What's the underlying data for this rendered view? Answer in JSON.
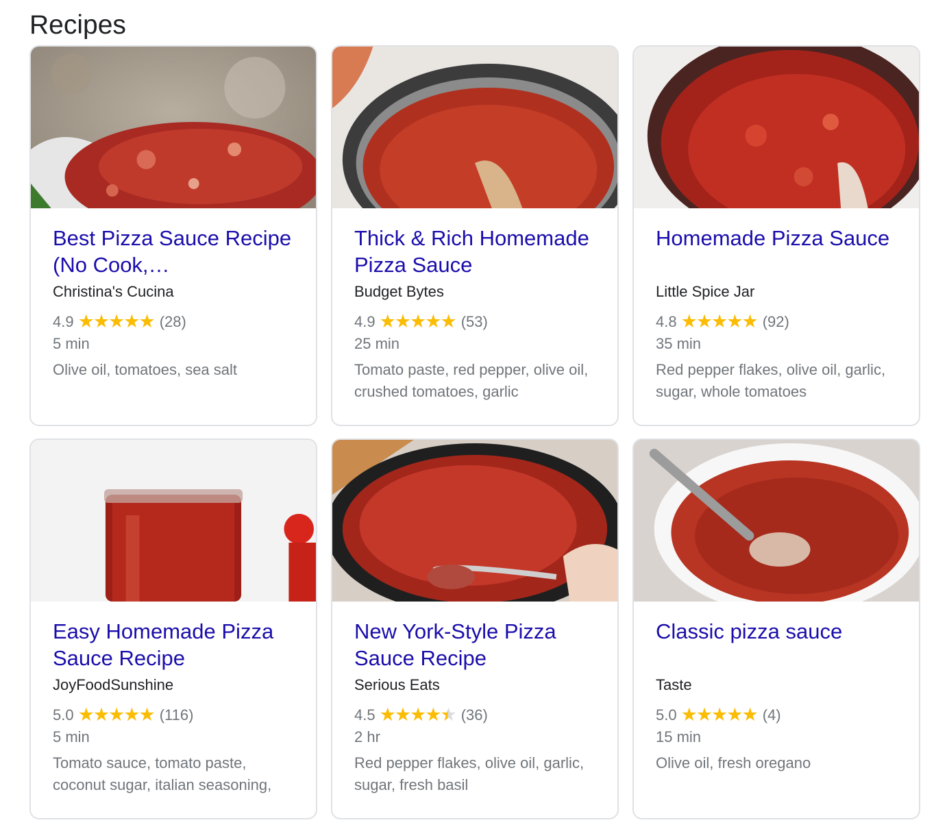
{
  "heading": "Recipes",
  "colors": {
    "title_link": "#1a0dab",
    "star": "#fbbc04",
    "meta": "#70757a",
    "sauce": "#c0301f"
  },
  "cards": [
    {
      "title": "Best Pizza Sauce Recipe (No Cook,…",
      "source": "Christina's Cucina",
      "rating": "4.9",
      "rating_value": 4.9,
      "reviews": "(28)",
      "time": "5 min",
      "ingredients": "Olive oil, tomatoes, sea salt",
      "image": "sauce-on-spoon-photo"
    },
    {
      "title": "Thick & Rich Homemade Pizza Sauce",
      "source": "Budget Bytes",
      "rating": "4.9",
      "rating_value": 4.9,
      "reviews": "(53)",
      "time": "25 min",
      "ingredients": "Tomato paste, red pepper, olive oil, crushed tomatoes, garlic",
      "image": "sauce-in-pot-photo"
    },
    {
      "title": "Homemade Pizza Sauce",
      "source": "Little Spice Jar",
      "rating": "4.8",
      "rating_value": 4.8,
      "reviews": "(92)",
      "time": "35 min",
      "ingredients": "Red pepper flakes, olive oil, garlic, sugar, whole tomatoes",
      "image": "chunky-sauce-pot-photo"
    },
    {
      "title": "Easy Homemade Pizza Sauce Recipe",
      "source": "JoyFoodSunshine",
      "rating": "5.0",
      "rating_value": 5.0,
      "reviews": "(116)",
      "time": "5 min",
      "ingredients": "Tomato sauce, tomato paste, coconut sugar, italian seasoning,",
      "image": "sauce-jar-photo"
    },
    {
      "title": "New York-Style Pizza Sauce Recipe",
      "source": "Serious Eats",
      "rating": "4.5",
      "rating_value": 4.5,
      "reviews": "(36)",
      "time": "2 hr",
      "ingredients": "Red pepper flakes, olive oil, garlic, sugar, fresh basil",
      "image": "sauce-skillet-photo"
    },
    {
      "title": "Classic pizza sauce",
      "source": "Taste",
      "rating": "5.0",
      "rating_value": 5.0,
      "reviews": "(4)",
      "time": "15 min",
      "ingredients": "Olive oil, fresh oregano",
      "image": "sauce-bowl-blender-photo"
    }
  ]
}
